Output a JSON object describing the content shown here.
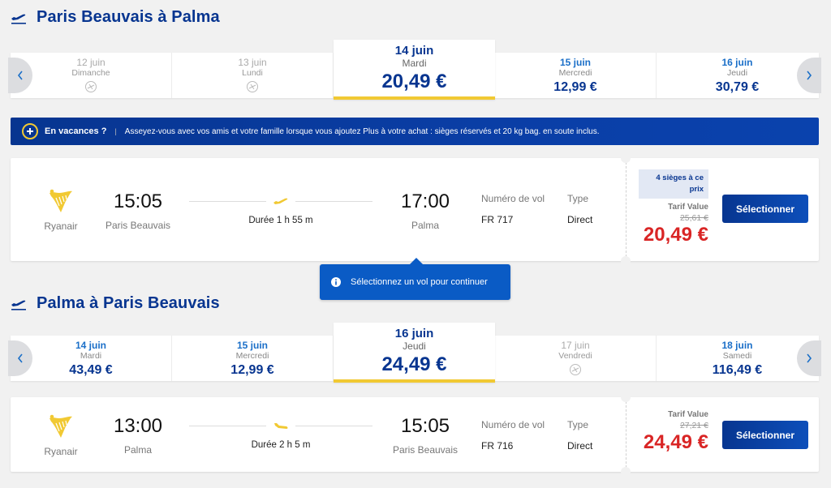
{
  "outbound": {
    "title": "Paris Beauvais à Palma",
    "icon": "plane-takeoff-icon",
    "dates": [
      {
        "date": "12 juin",
        "weekday": "Dimanche",
        "price": null,
        "available": false
      },
      {
        "date": "13 juin",
        "weekday": "Lundi",
        "price": null,
        "available": false
      },
      {
        "date": "14 juin",
        "weekday": "Mardi",
        "price": "20,49 €",
        "available": true,
        "selected": true
      },
      {
        "date": "15 juin",
        "weekday": "Mercredi",
        "price": "12,99 €",
        "available": true
      },
      {
        "date": "16 juin",
        "weekday": "Jeudi",
        "price": "30,79 €",
        "available": true
      }
    ],
    "flight": {
      "airline": "Ryanair",
      "depart_time": "15:05",
      "depart_city": "Paris Beauvais",
      "duration": "Durée 1 h 55 m",
      "arrive_time": "17:00",
      "arrive_city": "Palma",
      "flight_no_label": "Numéro de vol",
      "flight_no": "FR 717",
      "type_label": "Type",
      "type": "Direct",
      "seats_badge": "4 sièges à ce prix",
      "fare_name": "Tarif Value",
      "old_price": "25,61 €",
      "price": "20,49 €",
      "select_label": "Sélectionner"
    }
  },
  "banner": {
    "title": "En vacances ?",
    "separator": "|",
    "text": "Asseyez-vous avec vos amis et votre famille lorsque vous ajoutez Plus à votre achat : sièges réservés et 20 kg bag. en soute inclus."
  },
  "tooltip": {
    "text": "Sélectionnez un vol pour continuer"
  },
  "inbound": {
    "title": "Palma à Paris Beauvais",
    "icon": "plane-takeoff-icon",
    "dates": [
      {
        "date": "14 juin",
        "weekday": "Mardi",
        "price": "43,49 €",
        "available": true
      },
      {
        "date": "15 juin",
        "weekday": "Mercredi",
        "price": "12,99 €",
        "available": true
      },
      {
        "date": "16 juin",
        "weekday": "Jeudi",
        "price": "24,49 €",
        "available": true,
        "selected": true
      },
      {
        "date": "17 juin",
        "weekday": "Vendredi",
        "price": null,
        "available": false
      },
      {
        "date": "18 juin",
        "weekday": "Samedi",
        "price": "116,49 €",
        "available": true
      }
    ],
    "flight": {
      "airline": "Ryanair",
      "depart_time": "13:00",
      "depart_city": "Palma",
      "duration": "Durée 2 h 5 m",
      "arrive_time": "15:05",
      "arrive_city": "Paris Beauvais",
      "flight_no_label": "Numéro de vol",
      "flight_no": "FR 716",
      "type_label": "Type",
      "type": "Direct",
      "fare_name": "Tarif Value",
      "old_price": "27,21 €",
      "price": "24,49 €",
      "select_label": "Sélectionner"
    }
  },
  "colors": {
    "brand_blue": "#073590",
    "accent_yellow": "#f1c933",
    "price_red": "#d92525",
    "link_blue": "#1b6fc8"
  }
}
